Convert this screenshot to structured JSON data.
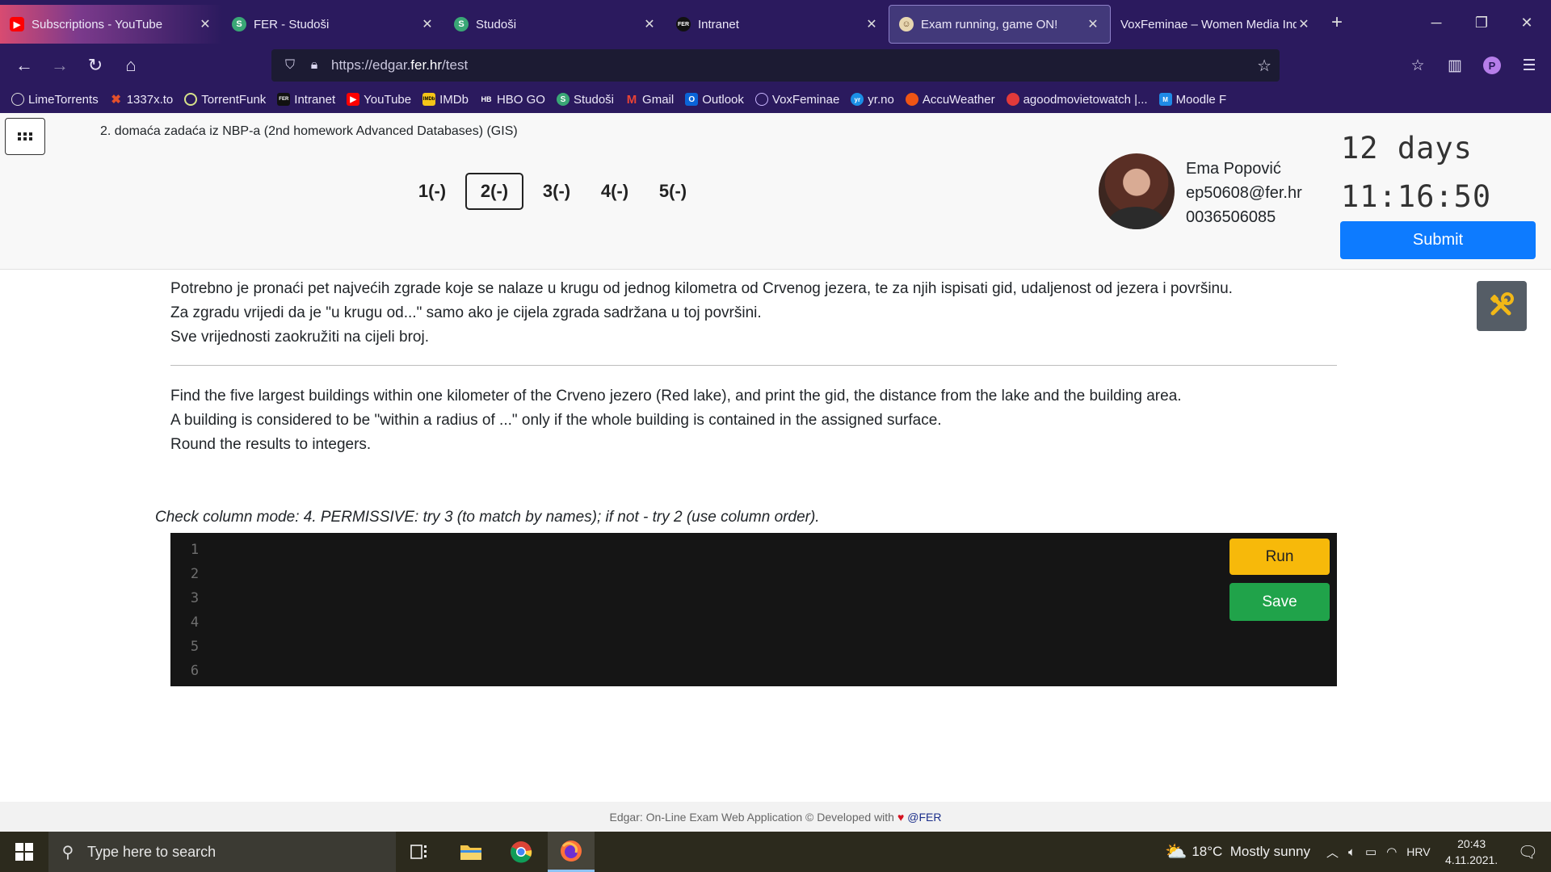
{
  "browser": {
    "tabs": [
      {
        "title": "Subscriptions - YouTube",
        "icon": "youtube-icon",
        "color": "#ff0000"
      },
      {
        "title": "FER - Studoši",
        "icon": "studosi-icon",
        "color": "#3aa776"
      },
      {
        "title": "Studoši",
        "icon": "studosi-icon",
        "color": "#3aa776"
      },
      {
        "title": "Intranet",
        "icon": "fer-icon",
        "color": "#222222"
      },
      {
        "title": "Exam running, game ON!",
        "icon": "edgar-icon",
        "color": "#e8d7b0"
      },
      {
        "title": "VoxFeminae – Women Media Indep",
        "icon": "voxfeminae-icon",
        "color": "#2b1a5e"
      }
    ],
    "url_prefix": "https://edgar.",
    "url_host": "fer.hr",
    "url_path": "/test",
    "bookmarks": [
      {
        "label": "LimeTorrents",
        "color": "#ffffff"
      },
      {
        "label": "1337x.to",
        "color": "#e3502b"
      },
      {
        "label": "TorrentFunk",
        "color": "#d6e28a"
      },
      {
        "label": "Intranet",
        "color": "#222222"
      },
      {
        "label": "YouTube",
        "color": "#ff0000"
      },
      {
        "label": "IMDb",
        "color": "#f5c518"
      },
      {
        "label": "HBO GO",
        "color": "#ffffff"
      },
      {
        "label": "Studoši",
        "color": "#3aa776"
      },
      {
        "label": "Gmail",
        "color": "#ea4335"
      },
      {
        "label": "Outlook",
        "color": "#0a64d8"
      },
      {
        "label": "VoxFeminae",
        "color": "#c9b6ff"
      },
      {
        "label": "yr.no",
        "color": "#1b8fe6"
      },
      {
        "label": "AccuWeather",
        "color": "#f05514"
      },
      {
        "label": "agoodmovietowatch |...",
        "color": "#e23a3a"
      },
      {
        "label": "Moodle F",
        "color": "#1f8ae6"
      }
    ]
  },
  "header": {
    "exam_title": "2. domaća zadaća iz NBP-a (2nd homework Advanced Databases) (GIS)",
    "questions": [
      "1(-)",
      "2(-)",
      "3(-)",
      "4(-)",
      "5(-)"
    ],
    "active_question": 1,
    "user": {
      "name": "Ema Popović",
      "email": "ep50608@fer.hr",
      "id": "0036506085"
    },
    "countdown_days": "12 days",
    "countdown_time": "11:16:50",
    "submit_label": "Submit"
  },
  "question": {
    "hr": [
      "Potrebno je pronaći pet najvećih zgrade koje se nalaze u krugu od jednog kilometra od Crvenog jezera, te za njih ispisati gid, udaljenost od jezera i površinu.",
      "Za zgradu vrijedi da je \"u krugu od...\" samo ako je cijela zgrada sadržana u toj površini.",
      "Sve vrijednosti zaokružiti na cijeli broj."
    ],
    "en": [
      "Find the five largest buildings within one kilometer of the Crveno jezero (Red lake), and print the gid, the distance from the lake and the building area.",
      "A building is considered to be \"within a radius of ...\" only if the whole building is contained in the assigned surface.",
      "Round the results to integers."
    ]
  },
  "editor": {
    "check_mode": "Check column mode: 4. PERMISSIVE: try 3 (to match by names); if not - try 2 (use column order).",
    "line_numbers": [
      "1",
      "2",
      "3",
      "4",
      "5",
      "6"
    ],
    "run_label": "Run",
    "save_label": "Save"
  },
  "footer": {
    "text": "Edgar: On-Line Exam Web Application © Developed with",
    "org": "@FER"
  },
  "taskbar": {
    "search_placeholder": "Type here to search",
    "weather": "18°C  Mostly sunny",
    "language": "HRV",
    "time": "20:43",
    "date": "4.11.2021."
  }
}
